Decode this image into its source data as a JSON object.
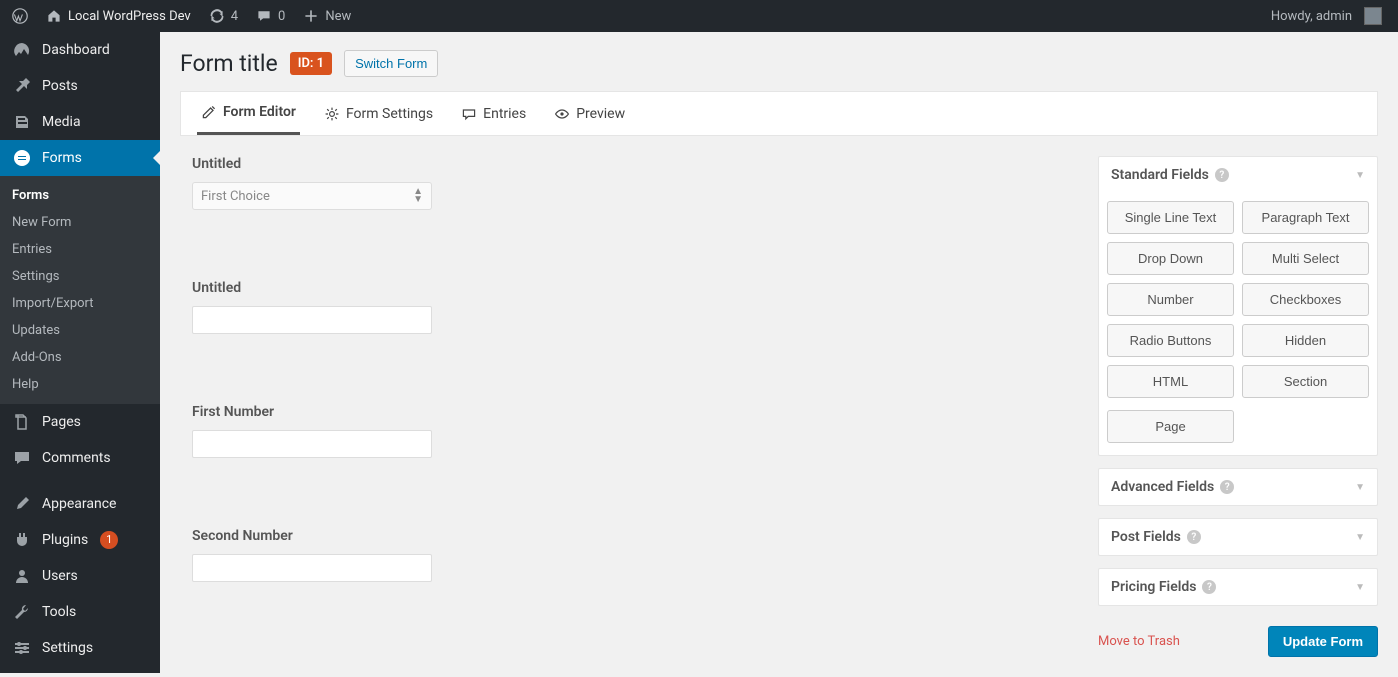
{
  "adminbar": {
    "siteName": "Local WordPress Dev",
    "updatesCount": "4",
    "commentsCount": "0",
    "newLabel": "New",
    "greeting": "Howdy, admin"
  },
  "sidebar": {
    "dashboard": "Dashboard",
    "posts": "Posts",
    "media": "Media",
    "forms": "Forms",
    "formsSub": {
      "forms": "Forms",
      "newForm": "New Form",
      "entries": "Entries",
      "settings": "Settings",
      "importExport": "Import/Export",
      "updates": "Updates",
      "addons": "Add-Ons",
      "help": "Help"
    },
    "pages": "Pages",
    "comments": "Comments",
    "appearance": "Appearance",
    "plugins": "Plugins",
    "pluginsBadge": "1",
    "users": "Users",
    "tools": "Tools",
    "settings": "Settings"
  },
  "page": {
    "title": "Form title",
    "idBadge": "ID: 1",
    "switch": "Switch Form"
  },
  "tabs": {
    "editor": "Form Editor",
    "settings": "Form Settings",
    "entries": "Entries",
    "preview": "Preview"
  },
  "canvas": {
    "field1_label": "Untitled",
    "field1_value": "First Choice",
    "field2_label": "Untitled",
    "field3_label": "First Number",
    "field4_label": "Second Number"
  },
  "panels": {
    "standard": "Standard Fields",
    "advanced": "Advanced Fields",
    "post": "Post Fields",
    "pricing": "Pricing Fields",
    "fields": {
      "singleLine": "Single Line Text",
      "paragraph": "Paragraph Text",
      "dropDown": "Drop Down",
      "multiSelect": "Multi Select",
      "number": "Number",
      "checkboxes": "Checkboxes",
      "radio": "Radio Buttons",
      "hidden": "Hidden",
      "html": "HTML",
      "section": "Section",
      "page": "Page"
    }
  },
  "actions": {
    "trash": "Move to Trash",
    "update": "Update Form"
  }
}
